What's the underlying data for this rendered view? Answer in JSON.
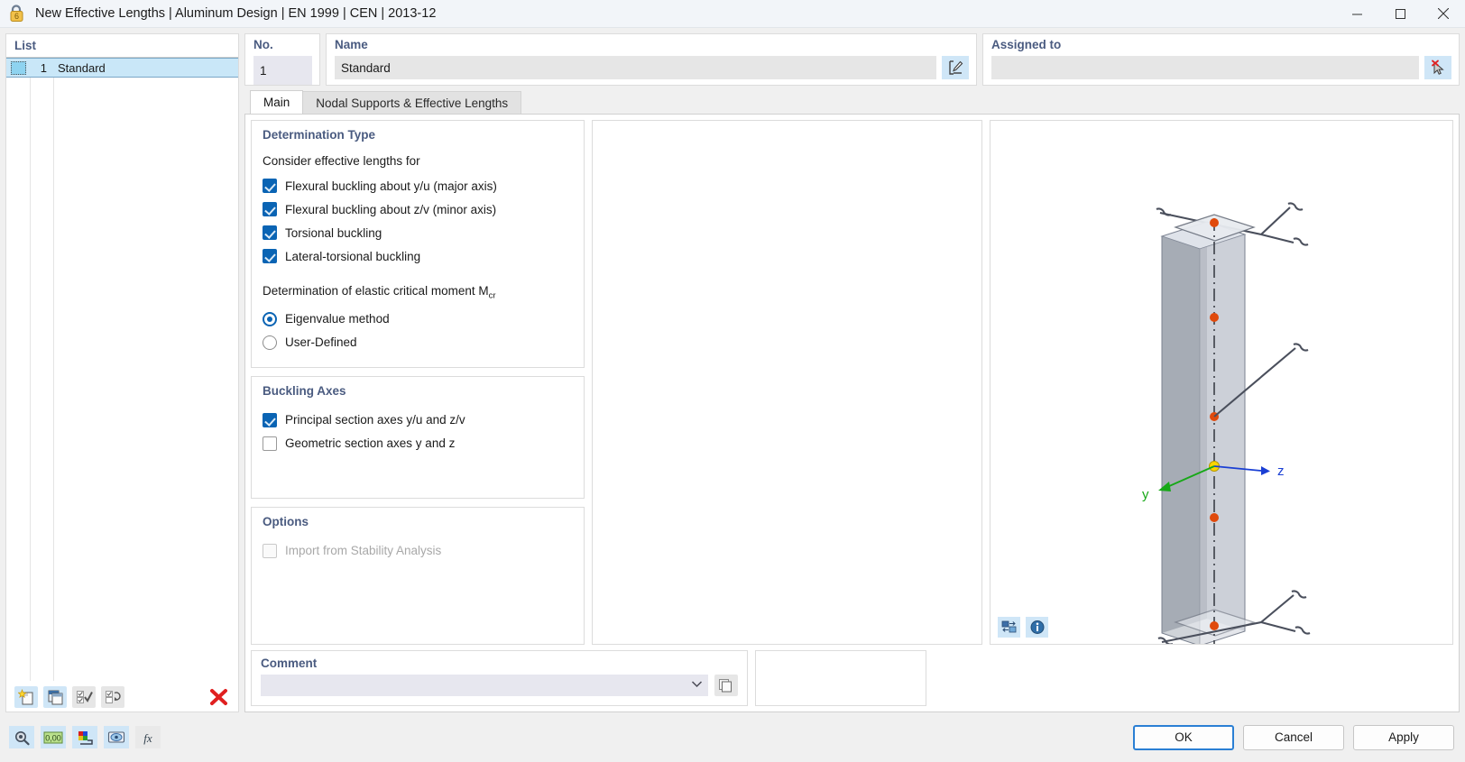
{
  "window": {
    "title": "New Effective Lengths | Aluminum Design | EN 1999 | CEN | 2013-12",
    "app_icon": "lock-shield-icon",
    "minimize_label": "Minimize",
    "maximize_label": "Maximize",
    "close_label": "Close"
  },
  "list": {
    "title": "List",
    "rows": [
      {
        "no": "1",
        "name": "Standard"
      }
    ],
    "toolbar": [
      {
        "name": "new-item-button",
        "label": "New"
      },
      {
        "name": "duplicate-item-button",
        "label": "Duplicate"
      },
      {
        "name": "select-all-button",
        "label": "Select All"
      },
      {
        "name": "invert-selection-button",
        "label": "Invert Selection"
      },
      {
        "name": "delete-item-button",
        "label": "Delete"
      }
    ]
  },
  "fields": {
    "no_label": "No.",
    "no_value": "1",
    "name_label": "Name",
    "name_value": "Standard",
    "name_edit_button": "edit-name-icon",
    "assigned_label": "Assigned to",
    "assigned_value": "",
    "assigned_pick_button": "pick-deselect-cursor-icon"
  },
  "tabs": [
    {
      "label": "Main",
      "active": true
    },
    {
      "label": "Nodal Supports & Effective Lengths",
      "active": false
    }
  ],
  "determination": {
    "title": "Determination Type",
    "consider_label": "Consider effective lengths for",
    "checkboxes": [
      {
        "label": "Flexural buckling about y/u (major axis)",
        "checked": true
      },
      {
        "label": "Flexural buckling about z/v (minor axis)",
        "checked": true
      },
      {
        "label": "Torsional buckling",
        "checked": true
      },
      {
        "label": "Lateral-torsional buckling",
        "checked": true
      }
    ],
    "mcr_label_main": "Determination of elastic critical moment M",
    "mcr_label_sub": "cr",
    "radios": [
      {
        "label": "Eigenvalue method",
        "selected": true
      },
      {
        "label": "User-Defined",
        "selected": false
      }
    ]
  },
  "buckling_axes": {
    "title": "Buckling Axes",
    "checkboxes": [
      {
        "label": "Principal section axes y/u and z/v",
        "checked": true
      },
      {
        "label": "Geometric section axes y and z",
        "checked": false
      }
    ]
  },
  "options": {
    "title": "Options",
    "checkboxes": [
      {
        "label": "Import from Stability Analysis",
        "checked": false,
        "disabled": true
      }
    ]
  },
  "comment": {
    "title": "Comment",
    "value": "",
    "placeholder": "",
    "dropdown_icon": "chevron-down-icon",
    "copy_button": "copy-comment-icon"
  },
  "view3d": {
    "axis_y_label": "y",
    "axis_z_label": "z",
    "tools": [
      {
        "name": "view-render-mode-button",
        "label": "Rendering Mode"
      },
      {
        "name": "view-info-button",
        "label": "Info"
      }
    ]
  },
  "status_bar": {
    "buttons": [
      {
        "name": "units-magnifier-button",
        "label": "Units"
      },
      {
        "name": "decimal-places-button",
        "label": "0,00"
      },
      {
        "name": "colors-button",
        "label": "Colors"
      },
      {
        "name": "display-properties-button",
        "label": "Display"
      },
      {
        "name": "formula-button",
        "label": "fx"
      }
    ]
  },
  "dialog_buttons": [
    {
      "label": "OK",
      "primary": true
    },
    {
      "label": "Cancel",
      "primary": false
    },
    {
      "label": "Apply",
      "primary": false
    }
  ],
  "colors": {
    "accent_blue": "#0a64b4",
    "group_title": "#4a5b80",
    "selection": "#c9e7f8",
    "delete_red": "#e02020",
    "axis_y_green": "#17a817",
    "axis_z_blue": "#1a3fd4",
    "node_orange": "#e04a0c",
    "focus_blue": "#2a7fd4"
  }
}
